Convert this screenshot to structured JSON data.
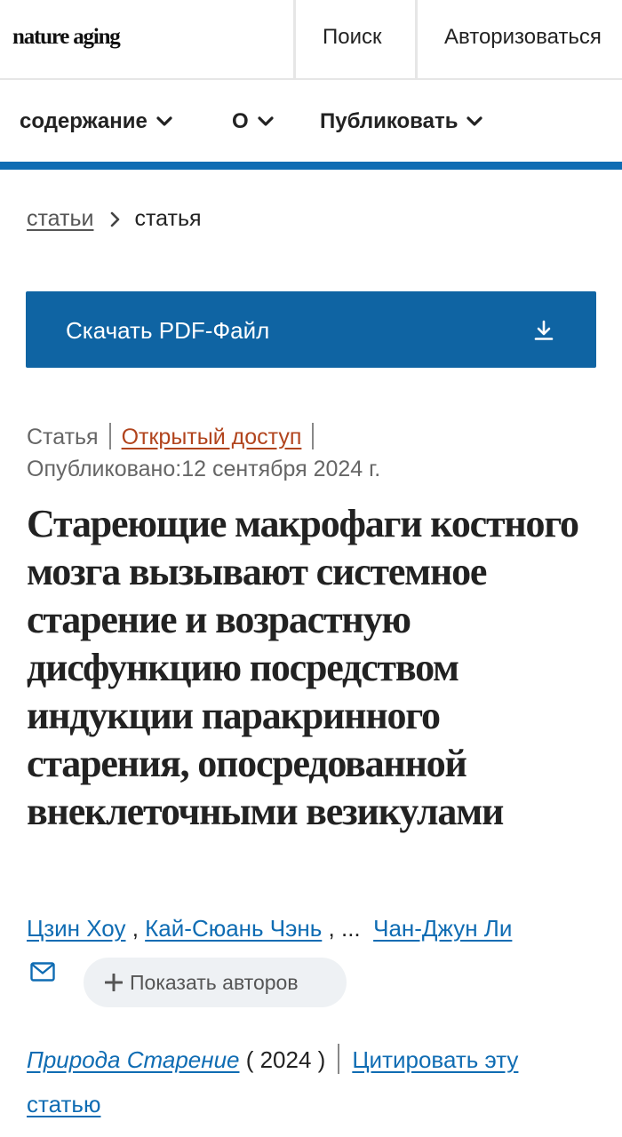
{
  "header": {
    "logo": "nature aging",
    "search_label": "Поиск",
    "login_label": "Авторизоваться"
  },
  "nav": {
    "items": [
      {
        "label": "содержание",
        "icon": "chevron-down-icon"
      },
      {
        "label": "О",
        "icon": "chevron-down-icon"
      },
      {
        "label": "Публиковать",
        "icon": "chevron-down-icon"
      }
    ]
  },
  "breadcrumb": {
    "parent": "статьи",
    "current": "статья"
  },
  "download": {
    "label": "Скачать PDF-Файл",
    "icon": "download-icon"
  },
  "article": {
    "type": "Статья",
    "access": "Открытый доступ",
    "published_label": "Опубликовано:",
    "published_date": "12 сентября 2024 г.",
    "title": "Стареющие макрофаги костного мозга вызывают системное старение и возрастную дисфункцию посредством индукции паракринного старения, опосредованной внеклеточными везикулами",
    "authors": [
      "Цзин Хоу",
      "Кай-Сюань Чэнь",
      "Чан-Джун Ли"
    ],
    "authors_ellipsis": "...",
    "show_authors_label": "Показать авторов",
    "journal": "Природа Старение",
    "year": "( 2024 )",
    "cite_label": "Цитировать эту статью"
  },
  "colors": {
    "accent": "#0f6cb3",
    "download_bg": "#0f64a3",
    "open_access": "#b1441d"
  }
}
